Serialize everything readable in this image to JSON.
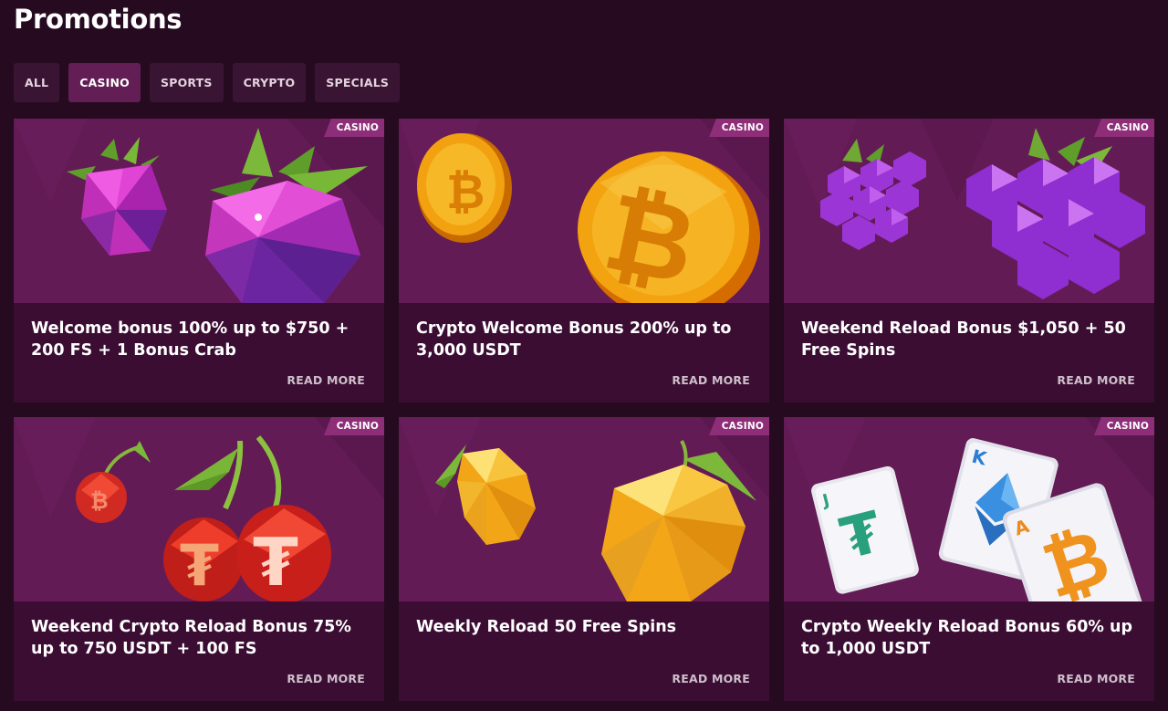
{
  "page": {
    "title": "Promotions"
  },
  "filters": [
    {
      "label": "ALL",
      "active": false
    },
    {
      "label": "CASINO",
      "active": true
    },
    {
      "label": "SPORTS",
      "active": false
    },
    {
      "label": "CRYPTO",
      "active": false
    },
    {
      "label": "SPECIALS",
      "active": false
    }
  ],
  "promotions": [
    {
      "badge": "CASINO",
      "title": "Welcome bonus 100% up to $750 + 200 FS + 1 Bonus Crab",
      "cta": "READ MORE",
      "art": "raspberry"
    },
    {
      "badge": "CASINO",
      "title": "Crypto Welcome Bonus 200% up to 3,000 USDT",
      "cta": "READ MORE",
      "art": "bitcoin-coin"
    },
    {
      "badge": "CASINO",
      "title": "Weekend Reload Bonus $1,050 + 50 Free Spins",
      "cta": "READ MORE",
      "art": "grapes"
    },
    {
      "badge": "CASINO",
      "title": "Weekend Crypto Reload Bonus 75% up to 750 USDT + 100 FS",
      "cta": "READ MORE",
      "art": "cherries"
    },
    {
      "badge": "CASINO",
      "title": "Weekly Reload 50 Free Spins",
      "cta": "READ MORE",
      "art": "lemon"
    },
    {
      "badge": "CASINO",
      "title": "Crypto Weekly Reload Bonus 60% up to 1,000 USDT",
      "cta": "READ MORE",
      "art": "playing-cards"
    }
  ],
  "colors": {
    "background": "#260a20",
    "card": "#3b0d33",
    "card_image": "#631b55",
    "active_tab": "#631e55",
    "tab": "#3a1433",
    "badge": "#8e2e79"
  }
}
